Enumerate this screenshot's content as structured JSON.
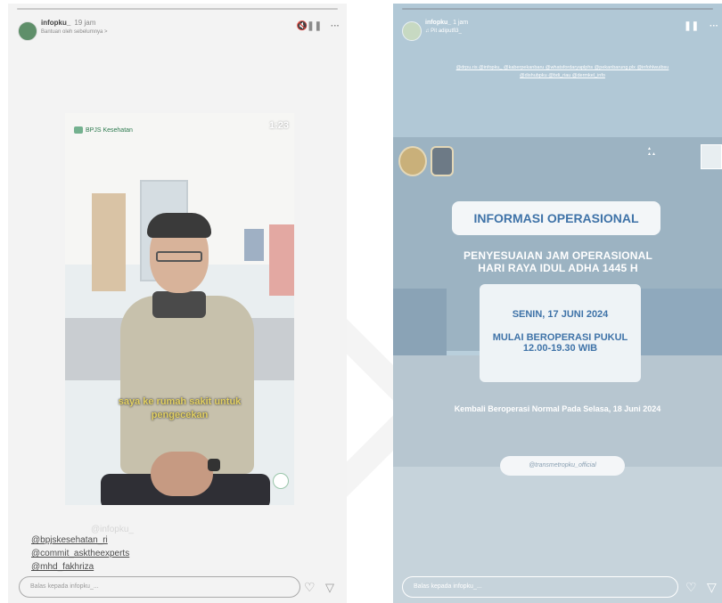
{
  "left_story": {
    "username": "infopku_",
    "time": "19 jam",
    "subtitle": "Bantuan oleh sebelumnya >",
    "video_timestamp": "1:23",
    "video_logo": "BPJS Kesehatan",
    "caption_line1": "saya ke rumah sakit untuk",
    "caption_line2": "pengecekan",
    "watermark": "@infopku_",
    "mentions": [
      "@bpjskesehatan_ri",
      "@commit_asktheexperts",
      "@mhd_fakhriza"
    ],
    "reply_placeholder": "Balas kepada infopku_..."
  },
  "right_story": {
    "username": "infopku_",
    "time": "1 jam",
    "subtitle": "♫ Pit adiputfi3_",
    "tags": "@drpu.ris @infopku_ @kaberpekanbaru @whatsfordaryaplphs @pekanbarung.plx @infohlwuibsu @dishubpku @bdi_riau @dermkel_info",
    "info_title": "INFORMASI OPERASIONAL",
    "adjust_line1": "PENYESUAIAN JAM OPERASIONAL",
    "adjust_line2": "HARI RAYA IDUL ADHA 1445 H",
    "date": "SENIN, 17 JUNI 2024",
    "operate_line1": "MULAI BEROPERASI PUKUL",
    "operate_line2": "12.00-19.30 WIB",
    "resume": "Kembali Beroperasi Normal Pada Selasa, 18 Juni 2024",
    "handle": "@transmetropku_official",
    "reply_placeholder": "Balas kepada infopku_..."
  },
  "icons": {
    "sound": "speaker-icon",
    "pause": "pause-icon",
    "more": "more-icon",
    "heart": "heart-icon",
    "send": "send-icon"
  },
  "colors": {
    "info_blue": "#3f73a8",
    "caption_yellow": "#e3d061"
  }
}
